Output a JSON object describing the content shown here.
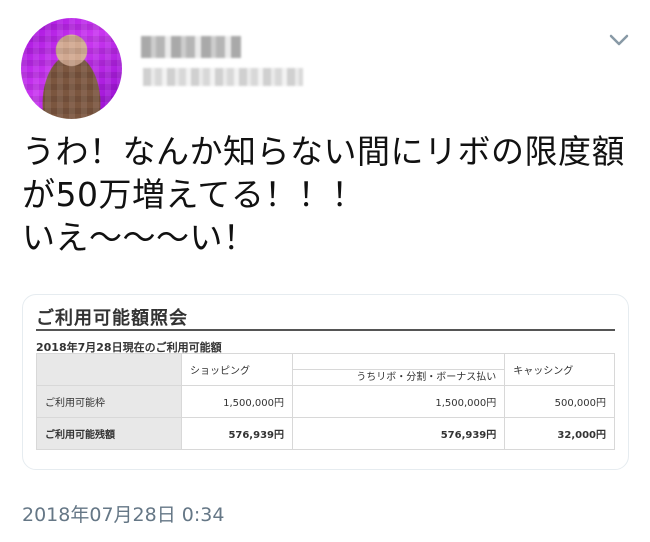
{
  "tweet": {
    "text_lines": [
      "うわ！なんか知らない間にリボの限度額",
      "が50万増えてる！！！",
      "いえ〜〜〜い！"
    ],
    "timestamp": "2018年07月28日 0:34"
  },
  "card": {
    "title": "ご利用可能額照会",
    "subtitle": "2018年7月28日現在のご利用可能額",
    "headers": {
      "shopping": "ショッピング",
      "revo": "うちリボ・分割・ボーナス払い",
      "cashing": "キャッシング"
    },
    "rows": [
      {
        "label": "ご利用可能枠",
        "shopping": "1,500,000円",
        "revo": "1,500,000円",
        "cashing": "500,000円"
      },
      {
        "label": "ご利用可能残額",
        "shopping": "576,939円",
        "revo": "576,939円",
        "cashing": "32,000円"
      }
    ]
  },
  "icons": {
    "menu": "chevron-down-icon",
    "avatar": "avatar"
  },
  "colors": {
    "timestamp": "#657786",
    "table_label_bg": "#e8e8e8",
    "card_border": "#e6ecf0"
  }
}
